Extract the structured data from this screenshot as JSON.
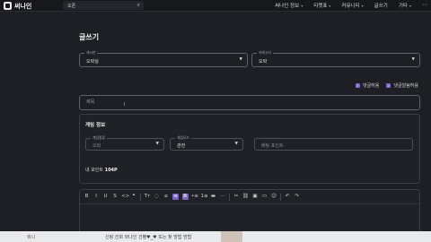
{
  "header": {
    "logo_text": "써나인",
    "search": {
      "value": "오픈"
    },
    "nav": [
      {
        "label": "써나인 정보",
        "has_dropdown": true
      },
      {
        "label": "티켓표",
        "has_dropdown": true
      },
      {
        "label": "커뮤니티",
        "has_dropdown": true
      },
      {
        "label": "글쓰기",
        "has_dropdown": false
      },
      {
        "label": "기타",
        "has_dropdown": true
      }
    ],
    "more_icon": "ellipsis-icon"
  },
  "page_title": "글쓰기",
  "board_select": {
    "label": "게시판",
    "value": "오락실"
  },
  "category_select": {
    "label": "카테고리",
    "value": "오락"
  },
  "options": [
    {
      "label": "댓글허용",
      "checked": true
    },
    {
      "label": "댓글알림허용",
      "checked": true
    }
  ],
  "title_input": {
    "placeholder": "제목"
  },
  "game_info": {
    "title": "게임 정보",
    "fields": [
      {
        "label": "게임종류",
        "value": "오락",
        "dim": true
      },
      {
        "label": "게임모드",
        "value": "관전",
        "dim": false
      },
      {
        "label": "",
        "value": "배팅 포인트",
        "dim": true
      }
    ],
    "points_label": "내 포인트",
    "points_value": "104P"
  },
  "editor_toolbar": [
    "B",
    "I",
    "U",
    "S",
    "<>",
    "❝",
    "Tт",
    "◌",
    "⌀",
    "≡",
    "≣",
    "•≡",
    "1≡",
    "▬",
    "⋯",
    "✂",
    "⛓",
    "▣",
    "▭",
    "☺",
    "↶",
    "↷"
  ],
  "bottom_bar": {
    "left": "뭐니",
    "text": "신랑 건희 와나인 건빵♥_♥ 또는 찾 방법 방법"
  },
  "colors": {
    "accent": "#7c62c2",
    "background": "#1d1f24"
  }
}
